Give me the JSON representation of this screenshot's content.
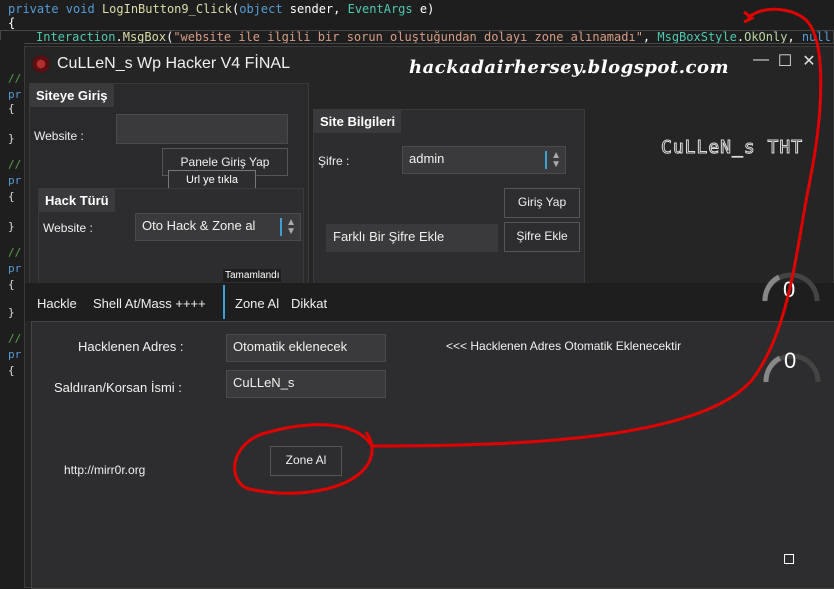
{
  "editor": {
    "line1_kw": "private void",
    "line1_fn": "LogInButton9_Click",
    "line1_rest_open": "(",
    "line1_kw2": "object",
    "line1_rest": " sender, ",
    "line1_ty": "EventArgs",
    "line1_end": " e)",
    "line2": "{",
    "line3_ty": "Interaction",
    "line3_dot": ".",
    "line3_fn": "MsgBox",
    "line3_open": "(",
    "line3_str": "\"website ile ilgili bir sorun oluştuğundan dolayı zone alınamadı\"",
    "line3_mid": ", ",
    "line3_ty2": "MsgBoxStyle",
    "line3_dot2": ".",
    "line3_kw": "OkOnly",
    "line3_mid2": ", ",
    "line3_kw2": "null",
    "line3_end": ");",
    "line4": "}",
    "gutter": [
      "//",
      "pr",
      "{",
      "}",
      "//",
      "pr",
      "{",
      "}",
      "//",
      "pr",
      "{",
      "}",
      "//",
      "pr",
      "{"
    ]
  },
  "window": {
    "title": "CuLLeN_s Wp Hacker V4 FİNAL",
    "blog": "hackadairhersey.blogspot.com",
    "minimize": "—",
    "maximize": "☐",
    "close": "✕",
    "brand": "CuLLeN_s THT"
  },
  "siteye_giris": {
    "header": "Siteye Giriş",
    "website_label": "Website  :",
    "website_value": "",
    "panel_button": "Panele Giriş Yap",
    "tooltip": "Url ye tıkla"
  },
  "hack_turu": {
    "header": "Hack Türü",
    "website_label": "Website  :",
    "selected": "Oto Hack & Zone al"
  },
  "site_bilgileri": {
    "header": "Site Bilgileri",
    "sifre_label": "Şifre  :",
    "sifre_value": "admin",
    "giris_button": "Giriş Yap",
    "farkli_label": "Farklı Bir Şifre Ekle",
    "sifre_ekle_button": "Şifre Ekle"
  },
  "tabs": {
    "status": "Tamamlandı",
    "items": [
      "Hackle",
      "Shell At/Mass ++++",
      "Zone Al",
      "Dikkat"
    ],
    "selected": "Zone Al"
  },
  "gauges": {
    "top": "0",
    "bottom": "0"
  },
  "zone": {
    "hacklenen_label": "Hacklenen Adres :",
    "hacklenen_value": "Otomatik eklenecek",
    "note": "<<< Hacklenen Adres Otomatik Eklenecektir",
    "saldiran_label": "Saldıran/Korsan İsmi :",
    "saldiran_value": "CuLLeN_s",
    "mirror_link": "http://mirr0r.org",
    "zone_button": "Zone Al"
  },
  "colors": {
    "annotation": "#e00000",
    "accent": "#3c9fd6"
  }
}
